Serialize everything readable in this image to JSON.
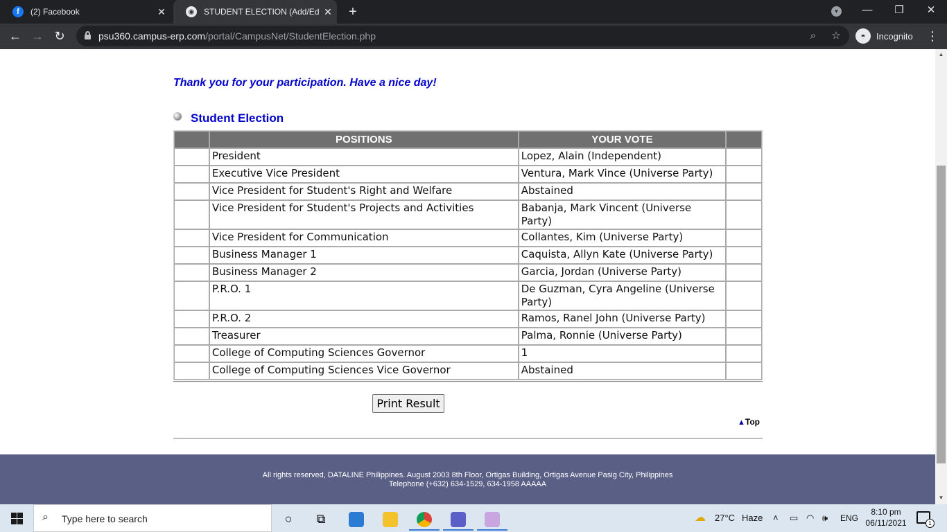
{
  "browser": {
    "tabs": [
      {
        "title": "(2) Facebook",
        "icon": "facebook-icon",
        "active": false
      },
      {
        "title": "STUDENT ELECTION (Add/Edit/D",
        "icon": "globe-icon",
        "active": true
      }
    ],
    "url_host": "psu360.campus-erp.com",
    "url_path": "/portal/CampusNet/StudentElection.php",
    "profile_label": "Incognito"
  },
  "page": {
    "thanks_message": "Thank you for your participation. Have a nice day!",
    "section_title": "Student Election",
    "table": {
      "headers": [
        "",
        "POSITIONS",
        "YOUR VOTE",
        ""
      ],
      "rows": [
        {
          "position": "President",
          "vote": "Lopez, Alain (Independent)"
        },
        {
          "position": "Executive Vice President",
          "vote": "Ventura, Mark Vince (Universe Party)"
        },
        {
          "position": "Vice President for Student's Right and Welfare",
          "vote": "Abstained"
        },
        {
          "position": "Vice President for Student's Projects and Activities",
          "vote": "Babanja, Mark Vincent (Universe Party)"
        },
        {
          "position": "Vice President for Communication",
          "vote": "Collantes, Kim (Universe Party)"
        },
        {
          "position": "Business Manager 1",
          "vote": "Caquista, Allyn Kate (Universe Party)"
        },
        {
          "position": "Business Manager 2",
          "vote": "Garcia, Jordan (Universe Party)"
        },
        {
          "position": "P.R.O. 1",
          "vote": "De Guzman, Cyra Angeline (Universe Party)"
        },
        {
          "position": "P.R.O. 2",
          "vote": "Ramos, Ranel John (Universe Party)"
        },
        {
          "position": "Treasurer",
          "vote": "Palma, Ronnie (Universe Party)"
        },
        {
          "position": "College of Computing Sciences Governor",
          "vote": "1"
        },
        {
          "position": "College of Computing Sciences Vice Governor",
          "vote": "Abstained"
        }
      ]
    },
    "print_button": "Print Result",
    "top_link": "Top",
    "footer_line1": "All rights reserved, DATALINE Philippines. August 2003 8th Floor, Ortigas Building, Ortigas Avenue Pasig City, Philippines",
    "footer_line2": "Telephone (+632) 634-1529, 634-1958 AAAAA"
  },
  "taskbar": {
    "search_placeholder": "Type here to search",
    "weather_temp": "27°C",
    "weather_desc": "Haze",
    "language": "ENG",
    "time": "8:10 pm",
    "date": "06/11/2021",
    "notification_count": "1"
  },
  "colors": {
    "link_blue": "#0000cc",
    "header_gray": "#707070",
    "footer_bg": "#5a5f86",
    "chrome_dark": "#202124"
  }
}
